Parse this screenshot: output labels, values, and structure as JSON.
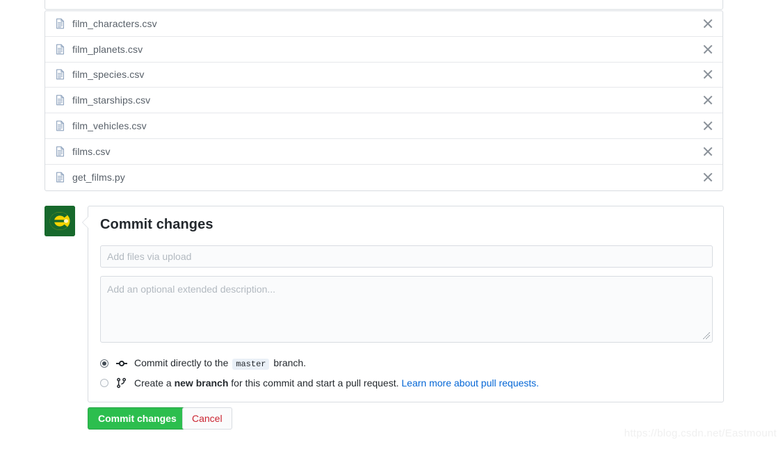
{
  "file_list": {
    "remove_icon": "close-icon",
    "file_icon": "file-document-icon",
    "files": [
      {
        "name": "film_characters.csv"
      },
      {
        "name": "film_planets.csv"
      },
      {
        "name": "film_species.csv"
      },
      {
        "name": "film_starships.csv"
      },
      {
        "name": "film_vehicles.csv"
      },
      {
        "name": "films.csv"
      },
      {
        "name": "get_films.py"
      }
    ]
  },
  "avatar": {
    "name": "user-avatar",
    "background_color": "#17692c",
    "logo_color": "#f5d400"
  },
  "commit": {
    "title": "Commit changes",
    "message_value": "",
    "message_placeholder": "Add files via upload",
    "description_value": "",
    "description_placeholder": "Add an optional extended description...",
    "options": [
      {
        "id": "commit-directly",
        "icon": "git-commit-icon",
        "selected": true,
        "text_before": "Commit directly to the",
        "badge": "master",
        "text_after": "branch."
      },
      {
        "id": "create-new-branch",
        "icon": "git-branch-icon",
        "selected": false,
        "text_before": "Create a",
        "bold": "new branch",
        "text_after": "for this commit and start a pull request.",
        "link_text": "Learn more about pull requests."
      }
    ]
  },
  "actions": {
    "commit_label": "Commit changes",
    "cancel_label": "Cancel",
    "commit_color": "#2cbe4e",
    "cancel_color": "#cb2431"
  },
  "watermark": {
    "text": "https://blog.csdn.net/Eastmount"
  }
}
